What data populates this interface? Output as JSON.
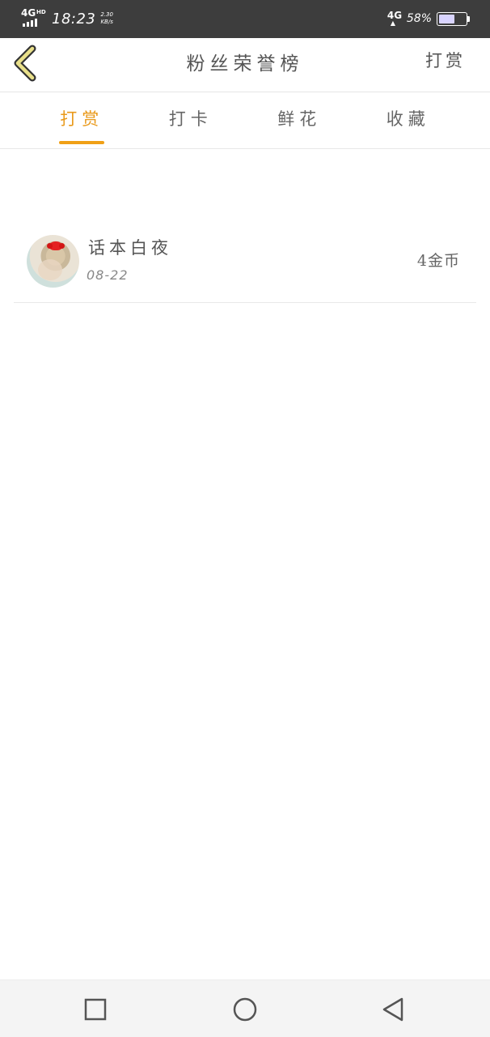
{
  "status_bar": {
    "network": "4G",
    "network_hd": "HD",
    "time": "18:23",
    "speed_value": "2.30",
    "speed_unit": "KB/s",
    "network_right": "4G",
    "battery_percent": "58%",
    "battery_level": 0.58
  },
  "header": {
    "back_icon": "chevron-left-icon",
    "title": "粉丝荣誉榜",
    "action_label": "打赏",
    "accent_color": "#e9c03a"
  },
  "tabs": [
    {
      "label": "打赏",
      "active": true
    },
    {
      "label": "打卡",
      "active": false
    },
    {
      "label": "鲜花",
      "active": false
    },
    {
      "label": "收藏",
      "active": false
    }
  ],
  "tab_accent_color": "#f0a016",
  "list": [
    {
      "name": "话本白夜",
      "date": "08-22",
      "amount": "4金币",
      "avatar_icon": "user-avatar"
    }
  ],
  "nav_bar": {
    "recent_icon": "square-icon",
    "home_icon": "circle-icon",
    "back_icon": "triangle-back-icon"
  }
}
